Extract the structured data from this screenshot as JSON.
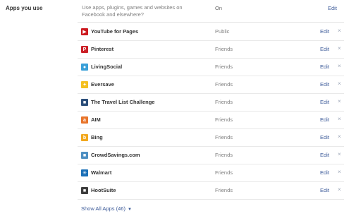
{
  "section": {
    "label": "Apps you use",
    "description": "Use apps, plugins, games and websites on Facebook and elsewhere?",
    "status": "On",
    "edit_label": "Edit"
  },
  "apps": [
    {
      "name": "YouTube for Pages",
      "audience": "Public",
      "edit": "Edit",
      "remove": "×",
      "icon": "youtube-icon",
      "icon_color": "#cc181e",
      "icon_glyph": "▶"
    },
    {
      "name": "Pinterest",
      "audience": "Friends",
      "edit": "Edit",
      "remove": "×",
      "icon": "pinterest-icon",
      "icon_color": "#cb2027",
      "icon_glyph": "P"
    },
    {
      "name": "LivingSocial",
      "audience": "Friends",
      "edit": "Edit",
      "remove": "×",
      "icon": "livingsocial-icon",
      "icon_color": "#3aa0d8",
      "icon_glyph": "●"
    },
    {
      "name": "Eversave",
      "audience": "Friends",
      "edit": "Edit",
      "remove": "×",
      "icon": "eversave-icon",
      "icon_color": "#f4c021",
      "icon_glyph": "✦"
    },
    {
      "name": "The Travel List Challenge",
      "audience": "Friends",
      "edit": "Edit",
      "remove": "×",
      "icon": "travel-list-icon",
      "icon_color": "#2b4e7a",
      "icon_glyph": "■"
    },
    {
      "name": "AIM",
      "audience": "Friends",
      "edit": "Edit",
      "remove": "×",
      "icon": "aim-icon",
      "icon_color": "#e8742a",
      "icon_glyph": "a"
    },
    {
      "name": "Bing",
      "audience": "Friends",
      "edit": "Edit",
      "remove": "×",
      "icon": "bing-icon",
      "icon_color": "#f2a81d",
      "icon_glyph": "b"
    },
    {
      "name": "CrowdSavings.com",
      "audience": "Friends",
      "edit": "Edit",
      "remove": "×",
      "icon": "crowdsavings-icon",
      "icon_color": "#4d8fc2",
      "icon_glyph": "■"
    },
    {
      "name": "Walmart",
      "audience": "Friends",
      "edit": "Edit",
      "remove": "×",
      "icon": "walmart-icon",
      "icon_color": "#1a6fb7",
      "icon_glyph": "✳"
    },
    {
      "name": "HootSuite",
      "audience": "Friends",
      "edit": "Edit",
      "remove": "×",
      "icon": "hootsuite-icon",
      "icon_color": "#3d3d3d",
      "icon_glyph": "■"
    }
  ],
  "footer": {
    "show_all_label": "Show All Apps (46)",
    "chevron": "▼"
  }
}
